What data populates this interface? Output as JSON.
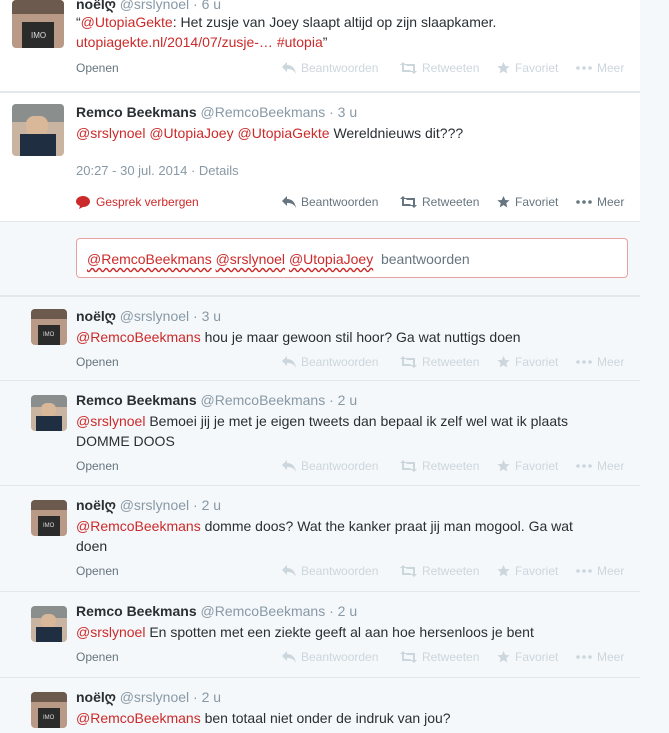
{
  "tweets": [
    {
      "fullname": "noëlღ",
      "username": "@srslynoel",
      "time": "· 6 u",
      "quote_open": "“",
      "mention": "@UtopiaGekte",
      "text": ": Het zusje van Joey slaapt altijd op zijn slaapkamer.",
      "link": "utopiagekte.nl/2014/07/zusje-…",
      "hashtag": "#utopia",
      "quote_close": "”",
      "open": "Openen"
    },
    {
      "fullname": "Remco Beekmans",
      "username": "@RemcoBeekmans",
      "time": "· 3 u",
      "mentions": [
        "@srslynoel",
        "@UtopiaJoey",
        "@UtopiaGekte"
      ],
      "text": "Wereldnieuws dit???",
      "timestamp": "20:27 - 30 jul. 2014",
      "details": "· Details",
      "hide_conversation": "Gesprek verbergen"
    },
    {
      "fullname": "noëlღ",
      "username": "@srslynoel",
      "time": "· 3 u",
      "mention": "@RemcoBeekmans",
      "text": "hou je maar gewoon stil hoor? Ga wat nuttigs doen",
      "open": "Openen"
    },
    {
      "fullname": "Remco Beekmans",
      "username": "@RemcoBeekmans",
      "time": "· 2 u",
      "mention": "@srslynoel",
      "text_line1": "Bemoei jij je met je eigen tweets dan bepaal ik zelf wel wat ik plaats",
      "text_line2": "DOMME DOOS",
      "open": "Openen"
    },
    {
      "fullname": "noëlღ",
      "username": "@srslynoel",
      "time": "· 2 u",
      "mention": "@RemcoBeekmans",
      "text_line1": "domme doos? Wat the kanker praat jij man mogool. Ga wat",
      "text_line2": "doen",
      "open": "Openen"
    },
    {
      "fullname": "Remco Beekmans",
      "username": "@RemcoBeekmans",
      "time": "· 2 u",
      "mention": "@srslynoel",
      "text": "En spotten met een ziekte geeft al aan hoe hersenloos je bent",
      "open": "Openen"
    },
    {
      "fullname": "noëlღ",
      "username": "@srslynoel",
      "time": "· 2 u",
      "mention": "@RemcoBeekmans",
      "text": "ben totaal niet onder de indruk van jou?"
    }
  ],
  "actions": {
    "reply": "Beantwoorden",
    "retweet": "Retweeten",
    "favorite": "Favoriet",
    "more": "Meer"
  },
  "reply_box": {
    "mentions": [
      "@RemcoBeekmans",
      "@srslynoel",
      "@UtopiaJoey"
    ],
    "placeholder": "beantwoorden"
  },
  "colors": {
    "accent": "#cc2a2a",
    "muted": "#8899a6",
    "faint_icons": "#ccd6dd",
    "background": "#f5f8fa"
  }
}
